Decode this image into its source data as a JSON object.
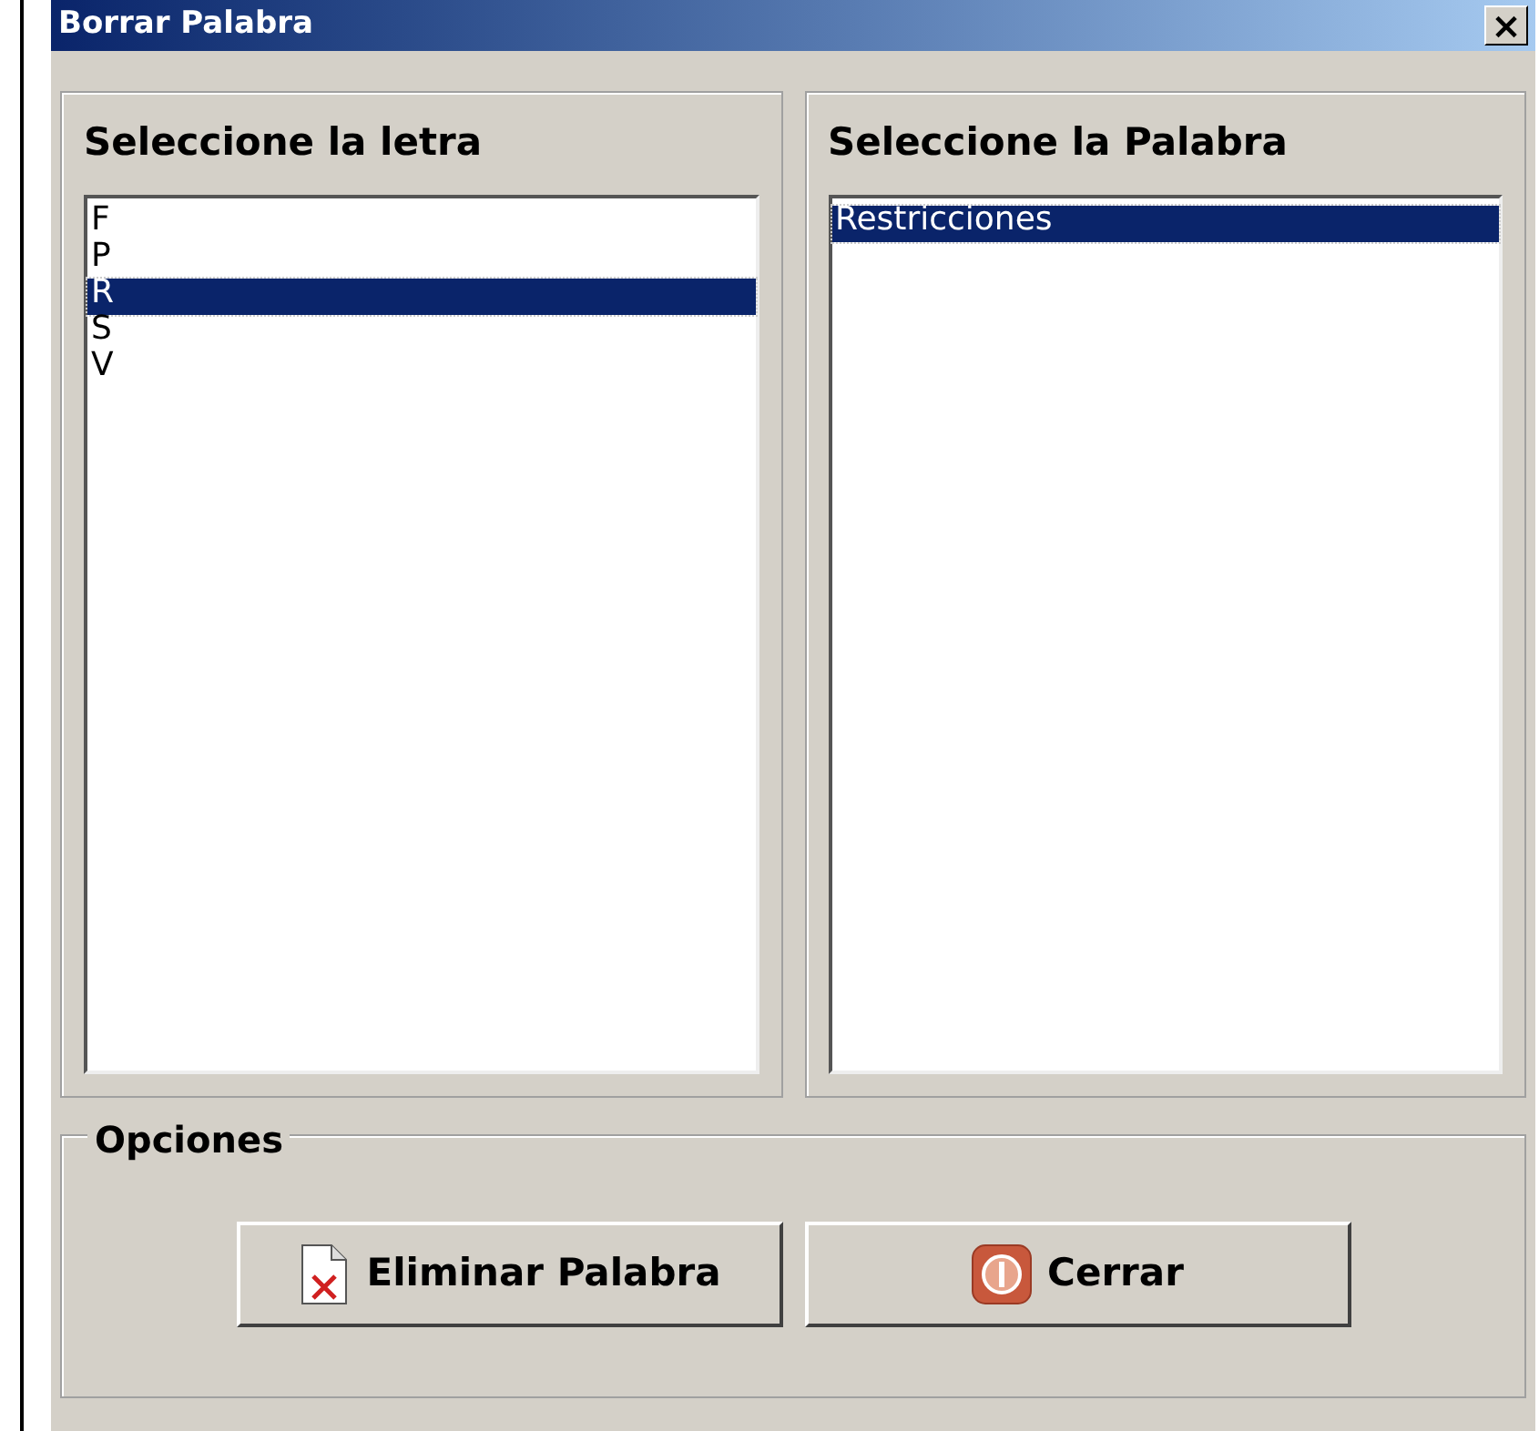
{
  "window": {
    "title": "Borrar Palabra",
    "close": "×"
  },
  "letters": {
    "title": "Seleccione la letra",
    "items": [
      {
        "label": "F",
        "selected": false
      },
      {
        "label": "P",
        "selected": false
      },
      {
        "label": "R",
        "selected": true
      },
      {
        "label": "S",
        "selected": false
      },
      {
        "label": "V",
        "selected": false
      }
    ]
  },
  "words": {
    "title": "Seleccione la Palabra",
    "items": [
      {
        "label": "Restricciones",
        "selected": true
      }
    ]
  },
  "options": {
    "title": "Opciones",
    "buttons": [
      {
        "label": "Eliminar Palabra",
        "kind": "delete"
      },
      {
        "label": "Cerrar",
        "kind": "close"
      }
    ]
  }
}
